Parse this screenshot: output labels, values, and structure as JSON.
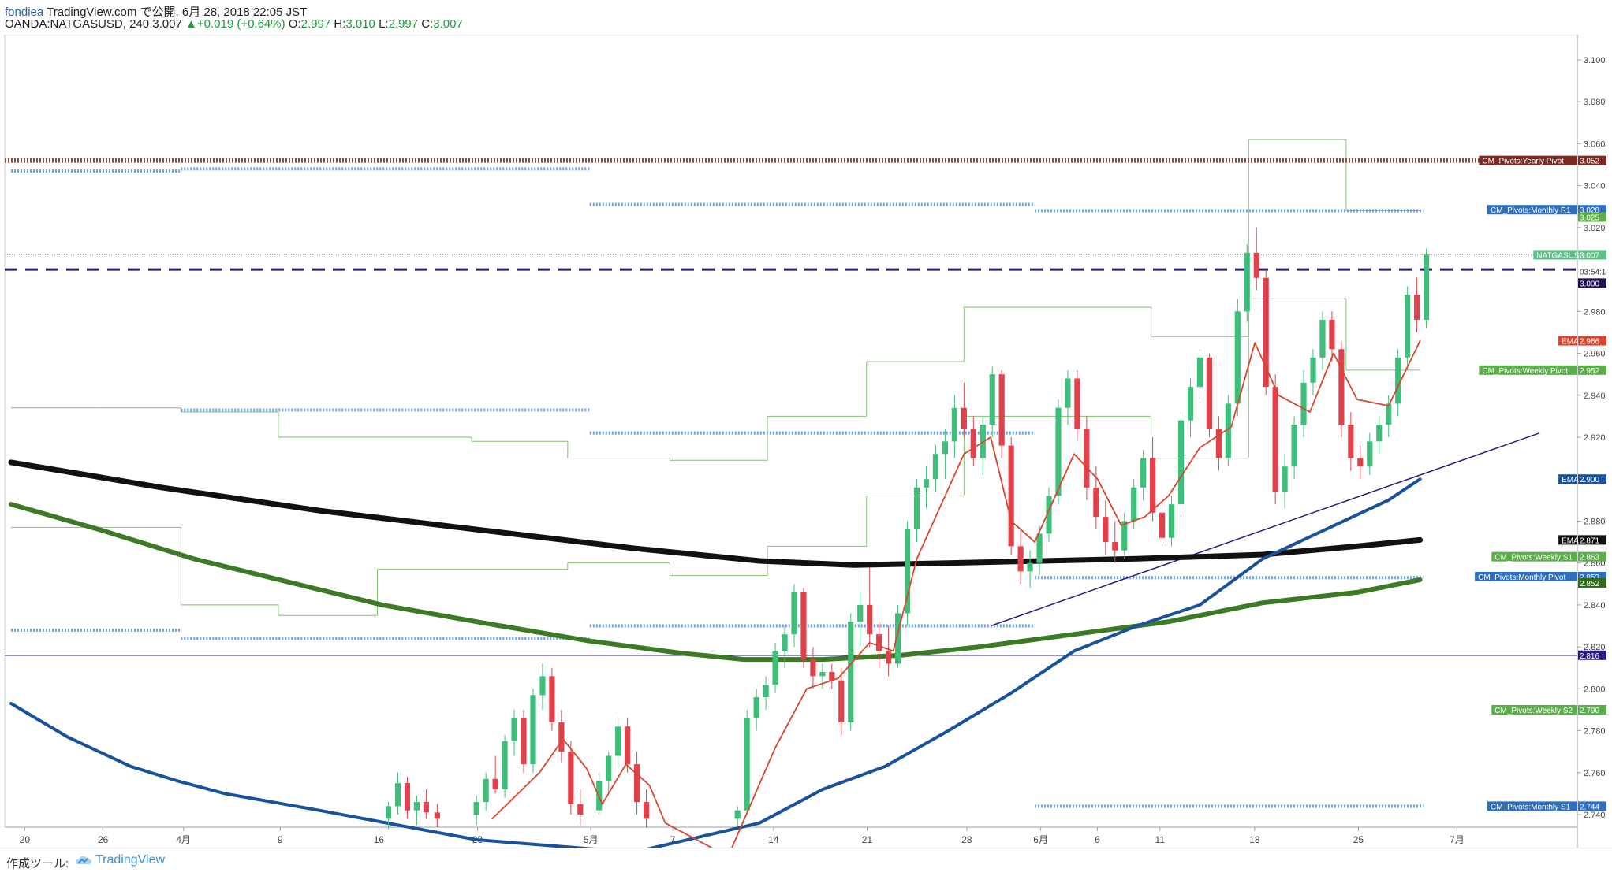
{
  "header": {
    "user": "fondiea",
    "published": "TradingView.com で公開, 6月 28, 2018 22:05 JST",
    "symbol": "OANDA:NATGASUSD, 240",
    "last": "3.007",
    "change": "+0.019 (+0.64%)",
    "o_label": "O:",
    "o": "2.997",
    "h_label": "H:",
    "h": "3.010",
    "l_label": "L:",
    "l": "2.997",
    "c_label": "C:",
    "c": "3.007"
  },
  "footer": {
    "made_with": "作成ツール:",
    "brand": "TradingView"
  },
  "colors": {
    "candle_up": "#3dbf7a",
    "candle_down": "#e0414b",
    "pivot_green": "#7fc26f",
    "pivot_blue": "#6fa3e6",
    "yearly": "#8a4a44",
    "black_ema": "#111111",
    "green_ema": "#3d7a25",
    "blue_ema": "#19529a",
    "red_ema": "#d9452e",
    "navy": "#2a1a7a"
  },
  "chart_data": {
    "type": "candlestick",
    "symbol": "OANDA:NATGASUSD",
    "timeframe": "240",
    "ylim": [
      2.734,
      3.112
    ],
    "y_ticks": [
      "3.100",
      "3.080",
      "3.060",
      "3.040",
      "3.020",
      "2.980",
      "2.960",
      "2.940",
      "2.920",
      "2.880",
      "2.860",
      "2.840",
      "2.820",
      "2.800",
      "2.780",
      "2.760",
      "2.740"
    ],
    "x_ticks": [
      {
        "label": "20",
        "pos": 0.0127
      },
      {
        "label": "26",
        "pos": 0.0625
      },
      {
        "label": "4月",
        "pos": 0.1137
      },
      {
        "label": "9",
        "pos": 0.1752
      },
      {
        "label": "16",
        "pos": 0.2379
      },
      {
        "label": "23",
        "pos": 0.3006
      },
      {
        "label": "5月",
        "pos": 0.3727
      },
      {
        "label": "7",
        "pos": 0.4248
      },
      {
        "label": "14",
        "pos": 0.4889
      },
      {
        "label": "21",
        "pos": 0.5484
      },
      {
        "label": "28",
        "pos": 0.6118
      },
      {
        "label": "6月",
        "pos": 0.6588
      },
      {
        "label": "6",
        "pos": 0.6948
      },
      {
        "label": "11",
        "pos": 0.7346
      },
      {
        "label": "18",
        "pos": 0.7948
      },
      {
        "label": "25",
        "pos": 0.8608
      },
      {
        "label": "7月",
        "pos": 0.9235
      }
    ],
    "labels": [
      {
        "text": "CM_Pivots:Yearly Pivot",
        "value": "3.052",
        "y": 3.052,
        "bg": "#7b2b22",
        "fg": "#ffffff"
      },
      {
        "text": "CM_Pivots:Monthly R1",
        "value": "3.028",
        "y": 3.0285,
        "bg": "#2e6fbf",
        "fg": "#ffffff"
      },
      {
        "text": "",
        "value": "3.025",
        "y": 3.025,
        "bg": "#5cae4a",
        "fg": "#ffffff"
      },
      {
        "text": "NATGASUSD",
        "value": "3.007",
        "y": 3.007,
        "bg": "#5dbf86",
        "fg": "#ffffff"
      },
      {
        "text": "",
        "value": "03:54:1",
        "y": 2.999,
        "bg": "#ffffff",
        "fg": "#333333"
      },
      {
        "text": "",
        "value": "3.000",
        "y": 2.9935,
        "bg": "#201050",
        "fg": "#ffffff"
      },
      {
        "text": "EMA",
        "value": "2.966",
        "y": 2.966,
        "bg": "#d9452e",
        "fg": "#ffffff"
      },
      {
        "text": "CM_Pivots:Weekly Pivot",
        "value": "2.952",
        "y": 2.952,
        "bg": "#5cae4a",
        "fg": "#ffffff"
      },
      {
        "text": "EMA",
        "value": "2.900",
        "y": 2.9,
        "bg": "#19529a",
        "fg": "#ffffff"
      },
      {
        "text": "EMA",
        "value": "2.871",
        "y": 2.871,
        "bg": "#111111",
        "fg": "#ffffff"
      },
      {
        "text": "CM_Pivots:Weekly S1",
        "value": "2.863",
        "y": 2.863,
        "bg": "#5cae4a",
        "fg": "#ffffff"
      },
      {
        "text": "CM_Pivots:Monthly Pivot",
        "value": "2.853",
        "y": 2.8535,
        "bg": "#2e6fbf",
        "fg": "#ffffff"
      },
      {
        "text": "",
        "value": "2.852",
        "y": 2.8505,
        "bg": "#2f6a1c",
        "fg": "#ffffff"
      },
      {
        "text": "",
        "value": "2.816",
        "y": 2.816,
        "bg": "#2a1a7a",
        "fg": "#ffffff"
      },
      {
        "text": "CM_Pivots:Weekly S2",
        "value": "2.790",
        "y": 2.79,
        "bg": "#5cae4a",
        "fg": "#ffffff"
      },
      {
        "text": "CM_Pivots:Monthly S1",
        "value": "2.744",
        "y": 2.744,
        "bg": "#2e6fbf",
        "fg": "#ffffff"
      }
    ],
    "levels": {
      "yearly_pivot": 3.052,
      "dashed_level": 3.0,
      "horizontal_line": 2.816,
      "current_price": 3.007
    },
    "trendline": [
      [
        0.627,
        2.83
      ],
      [
        0.976,
        2.922
      ]
    ],
    "monthly_pivot_segments": [
      {
        "x": [
          0.004,
          0.112
        ],
        "y": [
          3.047,
          2.828
        ]
      },
      {
        "x": [
          0.112,
          0.372
        ],
        "y": [
          3.048,
          2.933,
          2.824
        ]
      },
      {
        "x": [
          0.372,
          0.655
        ],
        "y": [
          3.031,
          2.922,
          2.83
        ]
      },
      {
        "x": [
          0.655,
          0.902
        ],
        "y": [
          3.028,
          2.853,
          2.744
        ]
      }
    ],
    "weekly_pivot_steps": [
      [
        0.004,
        2.934,
        2.877
      ],
      [
        0.061,
        2.934,
        2.877
      ],
      [
        0.112,
        2.932,
        2.84
      ],
      [
        0.174,
        2.92,
        2.835
      ],
      [
        0.237,
        2.92,
        2.857
      ],
      [
        0.297,
        2.918,
        2.857
      ],
      [
        0.358,
        2.91,
        2.86
      ],
      [
        0.423,
        2.909,
        2.854
      ],
      [
        0.485,
        2.93,
        2.868
      ],
      [
        0.548,
        2.956,
        2.892
      ],
      [
        0.61,
        2.982,
        2.93
      ],
      [
        0.668,
        2.982,
        2.93
      ],
      [
        0.729,
        2.968,
        2.91
      ],
      [
        0.791,
        3.062,
        2.986
      ],
      [
        0.853,
        3.028,
        2.952
      ],
      [
        0.9,
        3.028,
        2.952
      ]
    ],
    "ema_black": [
      [
        0.004,
        2.908
      ],
      [
        0.1,
        2.896
      ],
      [
        0.2,
        2.885
      ],
      [
        0.3,
        2.876
      ],
      [
        0.4,
        2.867
      ],
      [
        0.48,
        2.861
      ],
      [
        0.54,
        2.859
      ],
      [
        0.6,
        2.86
      ],
      [
        0.66,
        2.861
      ],
      [
        0.72,
        2.862
      ],
      [
        0.8,
        2.864
      ],
      [
        0.86,
        2.868
      ],
      [
        0.9,
        2.871
      ]
    ],
    "ema_green": [
      [
        0.004,
        2.888
      ],
      [
        0.06,
        2.876
      ],
      [
        0.12,
        2.862
      ],
      [
        0.18,
        2.851
      ],
      [
        0.24,
        2.84
      ],
      [
        0.3,
        2.832
      ],
      [
        0.37,
        2.823
      ],
      [
        0.43,
        2.817
      ],
      [
        0.47,
        2.814
      ],
      [
        0.52,
        2.814
      ],
      [
        0.57,
        2.816
      ],
      [
        0.62,
        2.82
      ],
      [
        0.68,
        2.826
      ],
      [
        0.74,
        2.832
      ],
      [
        0.8,
        2.841
      ],
      [
        0.86,
        2.846
      ],
      [
        0.9,
        2.852
      ]
    ],
    "ema_blue": [
      [
        0.004,
        2.793
      ],
      [
        0.04,
        2.777
      ],
      [
        0.08,
        2.763
      ],
      [
        0.11,
        2.756
      ],
      [
        0.14,
        2.75
      ],
      [
        0.2,
        2.742
      ],
      [
        0.3,
        2.728
      ],
      [
        0.4,
        2.722
      ],
      [
        0.48,
        2.736
      ],
      [
        0.52,
        2.752
      ],
      [
        0.56,
        2.763
      ],
      [
        0.6,
        2.78
      ],
      [
        0.64,
        2.798
      ],
      [
        0.68,
        2.818
      ],
      [
        0.72,
        2.83
      ],
      [
        0.76,
        2.84
      ],
      [
        0.8,
        2.862
      ],
      [
        0.84,
        2.876
      ],
      [
        0.88,
        2.89
      ],
      [
        0.9,
        2.9
      ]
    ],
    "ema_red": [
      [
        0.31,
        2.738
      ],
      [
        0.34,
        2.76
      ],
      [
        0.355,
        2.776
      ],
      [
        0.37,
        2.762
      ],
      [
        0.38,
        2.745
      ],
      [
        0.395,
        2.764
      ],
      [
        0.41,
        2.754
      ],
      [
        0.42,
        2.736
      ],
      [
        0.46,
        2.72
      ],
      [
        0.49,
        2.772
      ],
      [
        0.51,
        2.8
      ],
      [
        0.53,
        2.805
      ],
      [
        0.55,
        2.822
      ],
      [
        0.565,
        2.818
      ],
      [
        0.58,
        2.862
      ],
      [
        0.61,
        2.912
      ],
      [
        0.627,
        2.92
      ],
      [
        0.64,
        2.88
      ],
      [
        0.655,
        2.87
      ],
      [
        0.68,
        2.912
      ],
      [
        0.695,
        2.9
      ],
      [
        0.71,
        2.878
      ],
      [
        0.725,
        2.882
      ],
      [
        0.74,
        2.892
      ],
      [
        0.76,
        2.915
      ],
      [
        0.78,
        2.925
      ],
      [
        0.795,
        2.965
      ],
      [
        0.81,
        2.94
      ],
      [
        0.83,
        2.932
      ],
      [
        0.845,
        2.96
      ],
      [
        0.86,
        2.938
      ],
      [
        0.88,
        2.935
      ],
      [
        0.9,
        2.966
      ]
    ],
    "candles": [
      [
        0.244,
        2.738,
        2.746,
        2.733,
        2.744
      ],
      [
        0.25,
        2.744,
        2.76,
        2.74,
        2.755
      ],
      [
        0.256,
        2.755,
        2.758,
        2.738,
        2.742
      ],
      [
        0.262,
        2.742,
        2.749,
        2.735,
        2.746
      ],
      [
        0.268,
        2.746,
        2.752,
        2.738,
        2.741
      ],
      [
        0.275,
        2.741,
        2.745,
        2.734,
        2.738
      ],
      [
        0.3,
        2.74,
        2.749,
        2.735,
        2.746
      ],
      [
        0.306,
        2.746,
        2.76,
        2.742,
        2.757
      ],
      [
        0.312,
        2.757,
        2.768,
        2.75,
        2.752
      ],
      [
        0.318,
        2.752,
        2.778,
        2.748,
        2.775
      ],
      [
        0.324,
        2.775,
        2.79,
        2.768,
        2.786
      ],
      [
        0.33,
        2.786,
        2.79,
        2.76,
        2.764
      ],
      [
        0.336,
        2.764,
        2.8,
        2.76,
        2.797
      ],
      [
        0.342,
        2.797,
        2.812,
        2.79,
        2.806
      ],
      [
        0.348,
        2.806,
        2.81,
        2.78,
        2.784
      ],
      [
        0.354,
        2.784,
        2.79,
        2.765,
        2.77
      ],
      [
        0.36,
        2.77,
        2.775,
        2.74,
        2.745
      ],
      [
        0.366,
        2.745,
        2.752,
        2.735,
        2.74
      ],
      [
        0.378,
        2.742,
        2.76,
        2.74,
        2.756
      ],
      [
        0.384,
        2.756,
        2.77,
        2.75,
        2.768
      ],
      [
        0.39,
        2.768,
        2.786,
        2.762,
        2.782
      ],
      [
        0.396,
        2.782,
        2.786,
        2.76,
        2.764
      ],
      [
        0.402,
        2.764,
        2.77,
        2.74,
        2.746
      ],
      [
        0.408,
        2.746,
        2.752,
        2.734,
        2.738
      ],
      [
        0.466,
        2.738,
        2.744,
        2.734,
        2.742
      ],
      [
        0.472,
        2.742,
        2.79,
        2.74,
        2.786
      ],
      [
        0.478,
        2.786,
        2.8,
        2.78,
        2.796
      ],
      [
        0.484,
        2.796,
        2.806,
        2.79,
        2.802
      ],
      [
        0.49,
        2.802,
        2.822,
        2.798,
        2.818
      ],
      [
        0.496,
        2.818,
        2.83,
        2.81,
        2.826
      ],
      [
        0.502,
        2.826,
        2.85,
        2.82,
        2.846
      ],
      [
        0.508,
        2.846,
        2.848,
        2.81,
        2.814
      ],
      [
        0.514,
        2.814,
        2.82,
        2.8,
        2.806
      ],
      [
        0.52,
        2.806,
        2.812,
        2.8,
        2.808
      ],
      [
        0.526,
        2.808,
        2.812,
        2.8,
        2.804
      ],
      [
        0.532,
        2.804,
        2.81,
        2.778,
        2.784
      ],
      [
        0.538,
        2.784,
        2.836,
        2.78,
        2.832
      ],
      [
        0.544,
        2.832,
        2.846,
        2.82,
        2.84
      ],
      [
        0.55,
        2.84,
        2.858,
        2.82,
        2.826
      ],
      [
        0.556,
        2.826,
        2.832,
        2.81,
        2.818
      ],
      [
        0.562,
        2.818,
        2.83,
        2.806,
        2.812
      ],
      [
        0.568,
        2.812,
        2.84,
        2.81,
        2.836
      ],
      [
        0.574,
        2.836,
        2.88,
        2.83,
        2.876
      ],
      [
        0.58,
        2.876,
        2.9,
        2.87,
        2.896
      ],
      [
        0.586,
        2.896,
        2.906,
        2.886,
        2.9
      ],
      [
        0.592,
        2.9,
        2.916,
        2.894,
        2.912
      ],
      [
        0.598,
        2.912,
        2.924,
        2.9,
        2.918
      ],
      [
        0.604,
        2.918,
        2.94,
        2.91,
        2.934
      ],
      [
        0.61,
        2.934,
        2.946,
        2.92,
        2.924
      ],
      [
        0.616,
        2.924,
        2.93,
        2.906,
        2.91
      ],
      [
        0.622,
        2.91,
        2.93,
        2.902,
        2.926
      ],
      [
        0.628,
        2.926,
        2.954,
        2.92,
        2.95
      ],
      [
        0.634,
        2.95,
        2.952,
        2.91,
        2.916
      ],
      [
        0.64,
        2.916,
        2.92,
        2.864,
        2.868
      ],
      [
        0.646,
        2.868,
        2.876,
        2.85,
        2.856
      ],
      [
        0.652,
        2.856,
        2.866,
        2.848,
        2.86
      ],
      [
        0.658,
        2.86,
        2.878,
        2.854,
        2.874
      ],
      [
        0.664,
        2.874,
        2.896,
        2.87,
        2.892
      ],
      [
        0.67,
        2.892,
        2.938,
        2.888,
        2.934
      ],
      [
        0.676,
        2.934,
        2.952,
        2.926,
        2.948
      ],
      [
        0.682,
        2.948,
        2.952,
        2.918,
        2.924
      ],
      [
        0.688,
        2.924,
        2.93,
        2.89,
        2.896
      ],
      [
        0.694,
        2.896,
        2.906,
        2.876,
        2.882
      ],
      [
        0.7,
        2.882,
        2.89,
        2.864,
        2.87
      ],
      [
        0.706,
        2.87,
        2.88,
        2.86,
        2.866
      ],
      [
        0.712,
        2.866,
        2.884,
        2.862,
        2.88
      ],
      [
        0.718,
        2.88,
        2.9,
        2.876,
        2.896
      ],
      [
        0.724,
        2.896,
        2.914,
        2.89,
        2.91
      ],
      [
        0.73,
        2.91,
        2.92,
        2.88,
        2.884
      ],
      [
        0.736,
        2.884,
        2.89,
        2.868,
        2.872
      ],
      [
        0.742,
        2.872,
        2.892,
        2.868,
        2.888
      ],
      [
        0.748,
        2.888,
        2.932,
        2.884,
        2.928
      ],
      [
        0.754,
        2.928,
        2.948,
        2.92,
        2.944
      ],
      [
        0.76,
        2.944,
        2.962,
        2.938,
        2.958
      ],
      [
        0.766,
        2.958,
        2.96,
        2.92,
        2.924
      ],
      [
        0.772,
        2.924,
        2.93,
        2.904,
        2.91
      ],
      [
        0.778,
        2.91,
        2.94,
        2.906,
        2.936
      ],
      [
        0.784,
        2.936,
        2.986,
        2.93,
        2.98
      ],
      [
        0.79,
        2.98,
        3.012,
        2.975,
        3.008
      ],
      [
        0.796,
        3.008,
        3.02,
        2.99,
        2.996
      ],
      [
        0.802,
        2.996,
        3.0,
        2.94,
        2.944
      ],
      [
        0.808,
        2.944,
        2.95,
        2.888,
        2.894
      ],
      [
        0.814,
        2.894,
        2.912,
        2.886,
        2.906
      ],
      [
        0.82,
        2.906,
        2.93,
        2.9,
        2.926
      ],
      [
        0.826,
        2.926,
        2.952,
        2.92,
        2.946
      ],
      [
        0.832,
        2.946,
        2.962,
        2.94,
        2.958
      ],
      [
        0.838,
        2.958,
        2.98,
        2.952,
        2.976
      ],
      [
        0.844,
        2.976,
        2.98,
        2.956,
        2.962
      ],
      [
        0.85,
        2.962,
        2.966,
        2.92,
        2.926
      ],
      [
        0.856,
        2.926,
        2.932,
        2.904,
        2.91
      ],
      [
        0.862,
        2.91,
        2.916,
        2.9,
        2.906
      ],
      [
        0.868,
        2.906,
        2.922,
        2.902,
        2.918
      ],
      [
        0.874,
        2.918,
        2.93,
        2.912,
        2.926
      ],
      [
        0.88,
        2.926,
        2.94,
        2.92,
        2.936
      ],
      [
        0.886,
        2.936,
        2.962,
        2.93,
        2.958
      ],
      [
        0.892,
        2.958,
        2.992,
        2.952,
        2.988
      ],
      [
        0.898,
        2.988,
        2.996,
        2.97,
        2.976
      ],
      [
        0.904,
        2.976,
        3.01,
        2.972,
        3.007
      ]
    ]
  }
}
